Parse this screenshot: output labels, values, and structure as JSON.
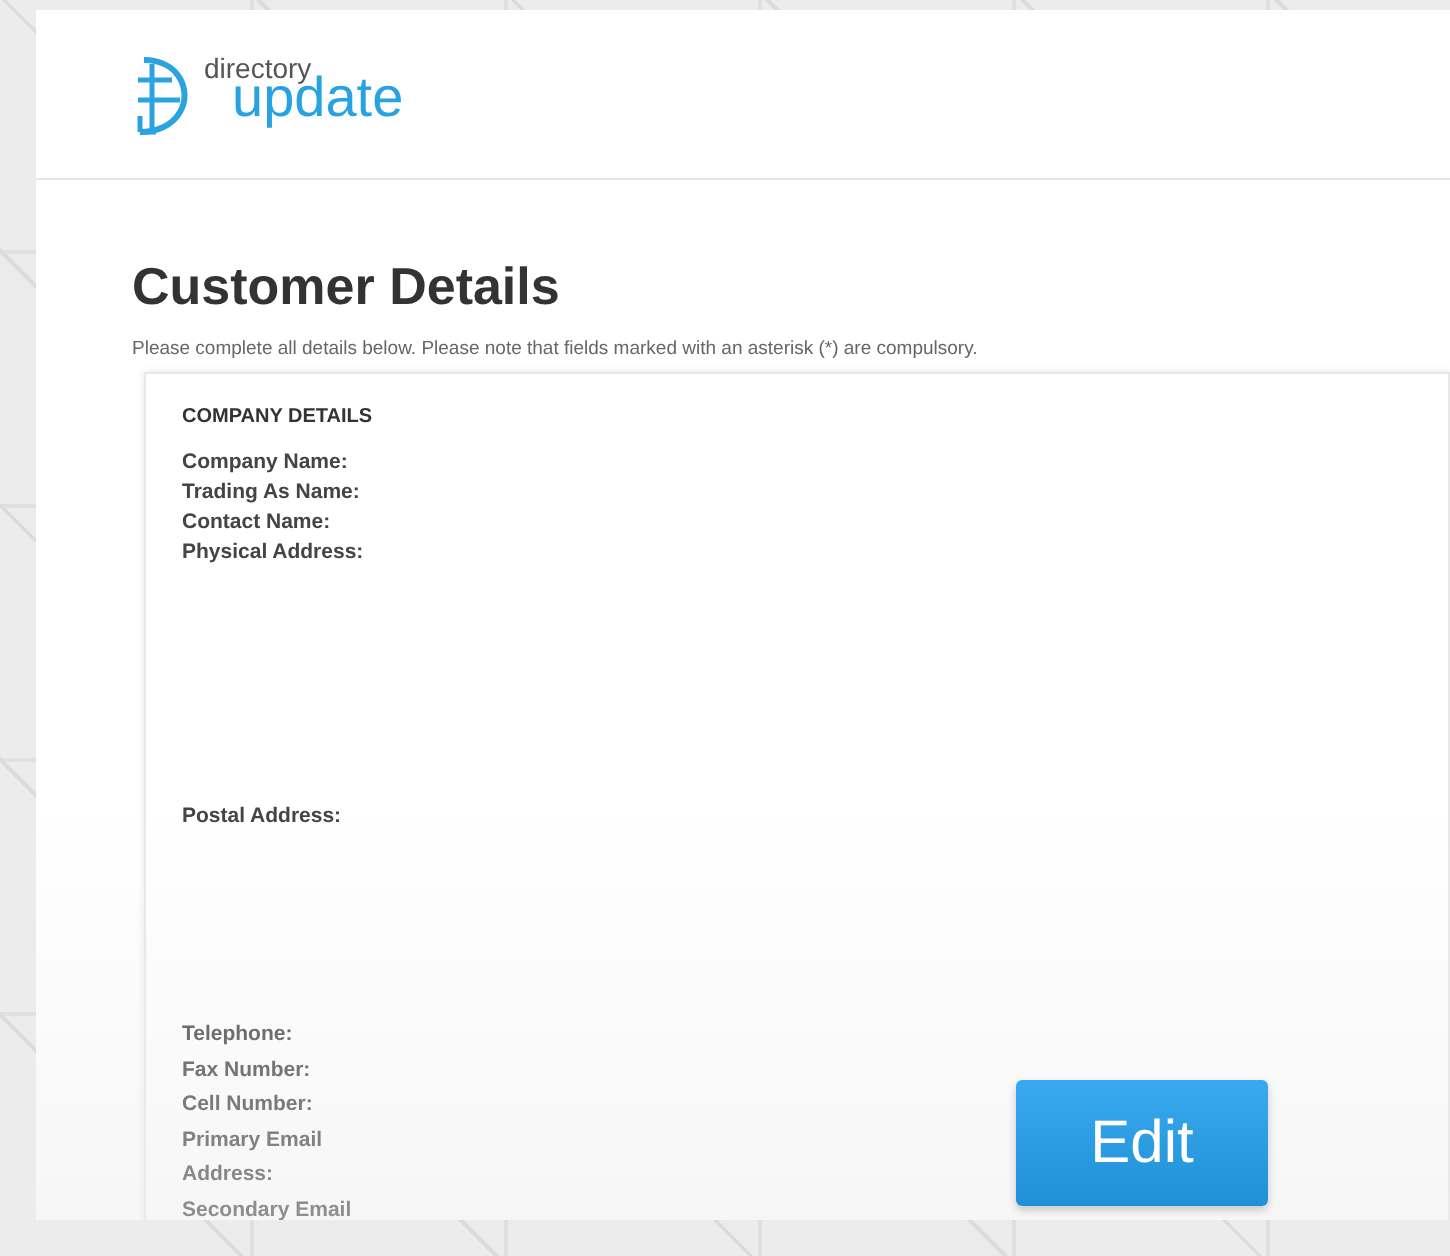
{
  "logo": {
    "small": "directory",
    "large": "update"
  },
  "heading": "Customer Details",
  "note": "Please complete all details below. Please note that fields marked with an asterisk (*) are compulsory.",
  "section": {
    "title": "COMPANY DETAILS",
    "groups": [
      {
        "labels": [
          "Company Name:",
          "Trading As Name:",
          "Contact Name:",
          "Physical Address:"
        ]
      },
      {
        "labels": [
          "Postal Address:"
        ]
      },
      {
        "labels": [
          "Telephone:",
          "Fax Number:",
          "Cell Number:",
          "Primary Email",
          "Address:",
          "Secondary Email"
        ]
      }
    ]
  },
  "button": "Edit"
}
